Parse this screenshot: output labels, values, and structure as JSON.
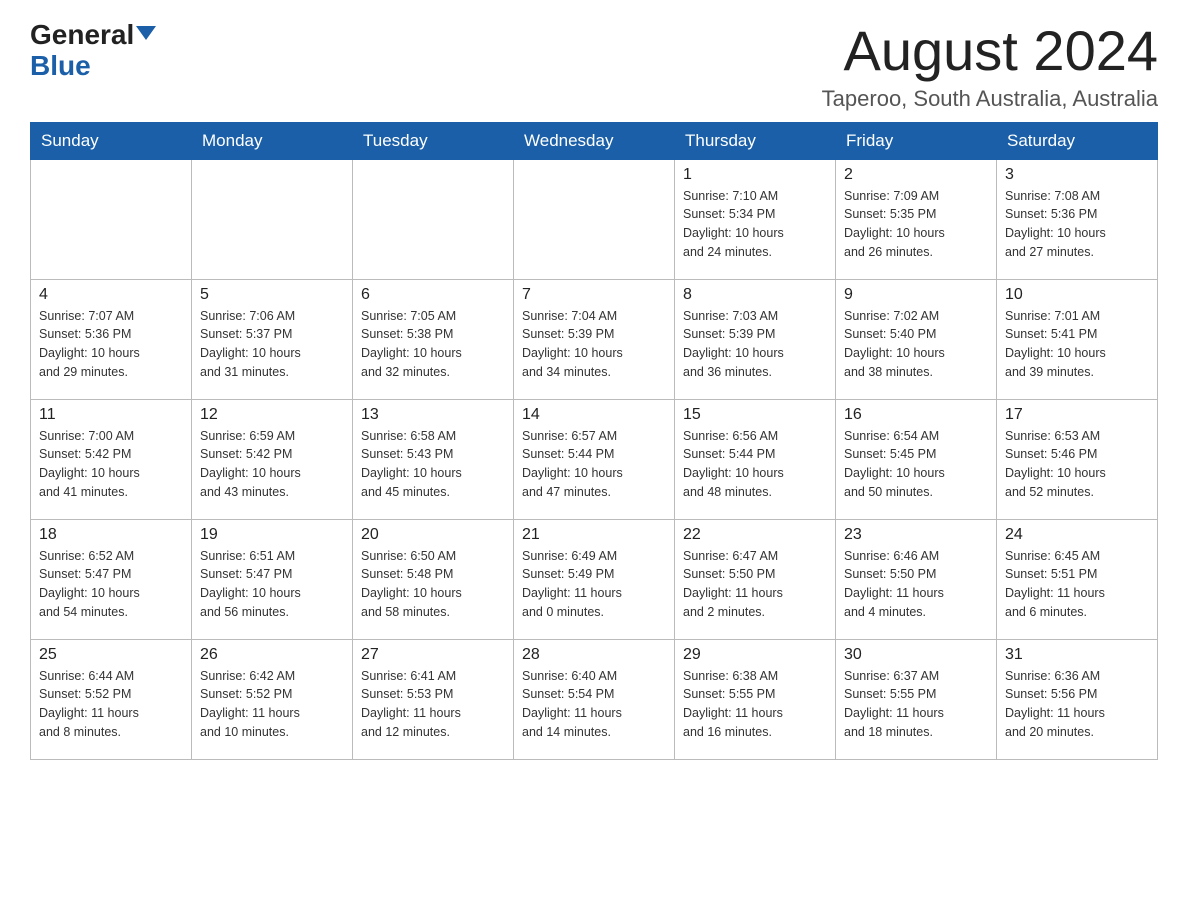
{
  "logo": {
    "text_general": "General",
    "text_blue": "Blue"
  },
  "header": {
    "month_title": "August 2024",
    "location": "Taperoo, South Australia, Australia"
  },
  "weekdays": [
    "Sunday",
    "Monday",
    "Tuesday",
    "Wednesday",
    "Thursday",
    "Friday",
    "Saturday"
  ],
  "weeks": [
    [
      {
        "day": "",
        "info": ""
      },
      {
        "day": "",
        "info": ""
      },
      {
        "day": "",
        "info": ""
      },
      {
        "day": "",
        "info": ""
      },
      {
        "day": "1",
        "info": "Sunrise: 7:10 AM\nSunset: 5:34 PM\nDaylight: 10 hours\nand 24 minutes."
      },
      {
        "day": "2",
        "info": "Sunrise: 7:09 AM\nSunset: 5:35 PM\nDaylight: 10 hours\nand 26 minutes."
      },
      {
        "day": "3",
        "info": "Sunrise: 7:08 AM\nSunset: 5:36 PM\nDaylight: 10 hours\nand 27 minutes."
      }
    ],
    [
      {
        "day": "4",
        "info": "Sunrise: 7:07 AM\nSunset: 5:36 PM\nDaylight: 10 hours\nand 29 minutes."
      },
      {
        "day": "5",
        "info": "Sunrise: 7:06 AM\nSunset: 5:37 PM\nDaylight: 10 hours\nand 31 minutes."
      },
      {
        "day": "6",
        "info": "Sunrise: 7:05 AM\nSunset: 5:38 PM\nDaylight: 10 hours\nand 32 minutes."
      },
      {
        "day": "7",
        "info": "Sunrise: 7:04 AM\nSunset: 5:39 PM\nDaylight: 10 hours\nand 34 minutes."
      },
      {
        "day": "8",
        "info": "Sunrise: 7:03 AM\nSunset: 5:39 PM\nDaylight: 10 hours\nand 36 minutes."
      },
      {
        "day": "9",
        "info": "Sunrise: 7:02 AM\nSunset: 5:40 PM\nDaylight: 10 hours\nand 38 minutes."
      },
      {
        "day": "10",
        "info": "Sunrise: 7:01 AM\nSunset: 5:41 PM\nDaylight: 10 hours\nand 39 minutes."
      }
    ],
    [
      {
        "day": "11",
        "info": "Sunrise: 7:00 AM\nSunset: 5:42 PM\nDaylight: 10 hours\nand 41 minutes."
      },
      {
        "day": "12",
        "info": "Sunrise: 6:59 AM\nSunset: 5:42 PM\nDaylight: 10 hours\nand 43 minutes."
      },
      {
        "day": "13",
        "info": "Sunrise: 6:58 AM\nSunset: 5:43 PM\nDaylight: 10 hours\nand 45 minutes."
      },
      {
        "day": "14",
        "info": "Sunrise: 6:57 AM\nSunset: 5:44 PM\nDaylight: 10 hours\nand 47 minutes."
      },
      {
        "day": "15",
        "info": "Sunrise: 6:56 AM\nSunset: 5:44 PM\nDaylight: 10 hours\nand 48 minutes."
      },
      {
        "day": "16",
        "info": "Sunrise: 6:54 AM\nSunset: 5:45 PM\nDaylight: 10 hours\nand 50 minutes."
      },
      {
        "day": "17",
        "info": "Sunrise: 6:53 AM\nSunset: 5:46 PM\nDaylight: 10 hours\nand 52 minutes."
      }
    ],
    [
      {
        "day": "18",
        "info": "Sunrise: 6:52 AM\nSunset: 5:47 PM\nDaylight: 10 hours\nand 54 minutes."
      },
      {
        "day": "19",
        "info": "Sunrise: 6:51 AM\nSunset: 5:47 PM\nDaylight: 10 hours\nand 56 minutes."
      },
      {
        "day": "20",
        "info": "Sunrise: 6:50 AM\nSunset: 5:48 PM\nDaylight: 10 hours\nand 58 minutes."
      },
      {
        "day": "21",
        "info": "Sunrise: 6:49 AM\nSunset: 5:49 PM\nDaylight: 11 hours\nand 0 minutes."
      },
      {
        "day": "22",
        "info": "Sunrise: 6:47 AM\nSunset: 5:50 PM\nDaylight: 11 hours\nand 2 minutes."
      },
      {
        "day": "23",
        "info": "Sunrise: 6:46 AM\nSunset: 5:50 PM\nDaylight: 11 hours\nand 4 minutes."
      },
      {
        "day": "24",
        "info": "Sunrise: 6:45 AM\nSunset: 5:51 PM\nDaylight: 11 hours\nand 6 minutes."
      }
    ],
    [
      {
        "day": "25",
        "info": "Sunrise: 6:44 AM\nSunset: 5:52 PM\nDaylight: 11 hours\nand 8 minutes."
      },
      {
        "day": "26",
        "info": "Sunrise: 6:42 AM\nSunset: 5:52 PM\nDaylight: 11 hours\nand 10 minutes."
      },
      {
        "day": "27",
        "info": "Sunrise: 6:41 AM\nSunset: 5:53 PM\nDaylight: 11 hours\nand 12 minutes."
      },
      {
        "day": "28",
        "info": "Sunrise: 6:40 AM\nSunset: 5:54 PM\nDaylight: 11 hours\nand 14 minutes."
      },
      {
        "day": "29",
        "info": "Sunrise: 6:38 AM\nSunset: 5:55 PM\nDaylight: 11 hours\nand 16 minutes."
      },
      {
        "day": "30",
        "info": "Sunrise: 6:37 AM\nSunset: 5:55 PM\nDaylight: 11 hours\nand 18 minutes."
      },
      {
        "day": "31",
        "info": "Sunrise: 6:36 AM\nSunset: 5:56 PM\nDaylight: 11 hours\nand 20 minutes."
      }
    ]
  ]
}
